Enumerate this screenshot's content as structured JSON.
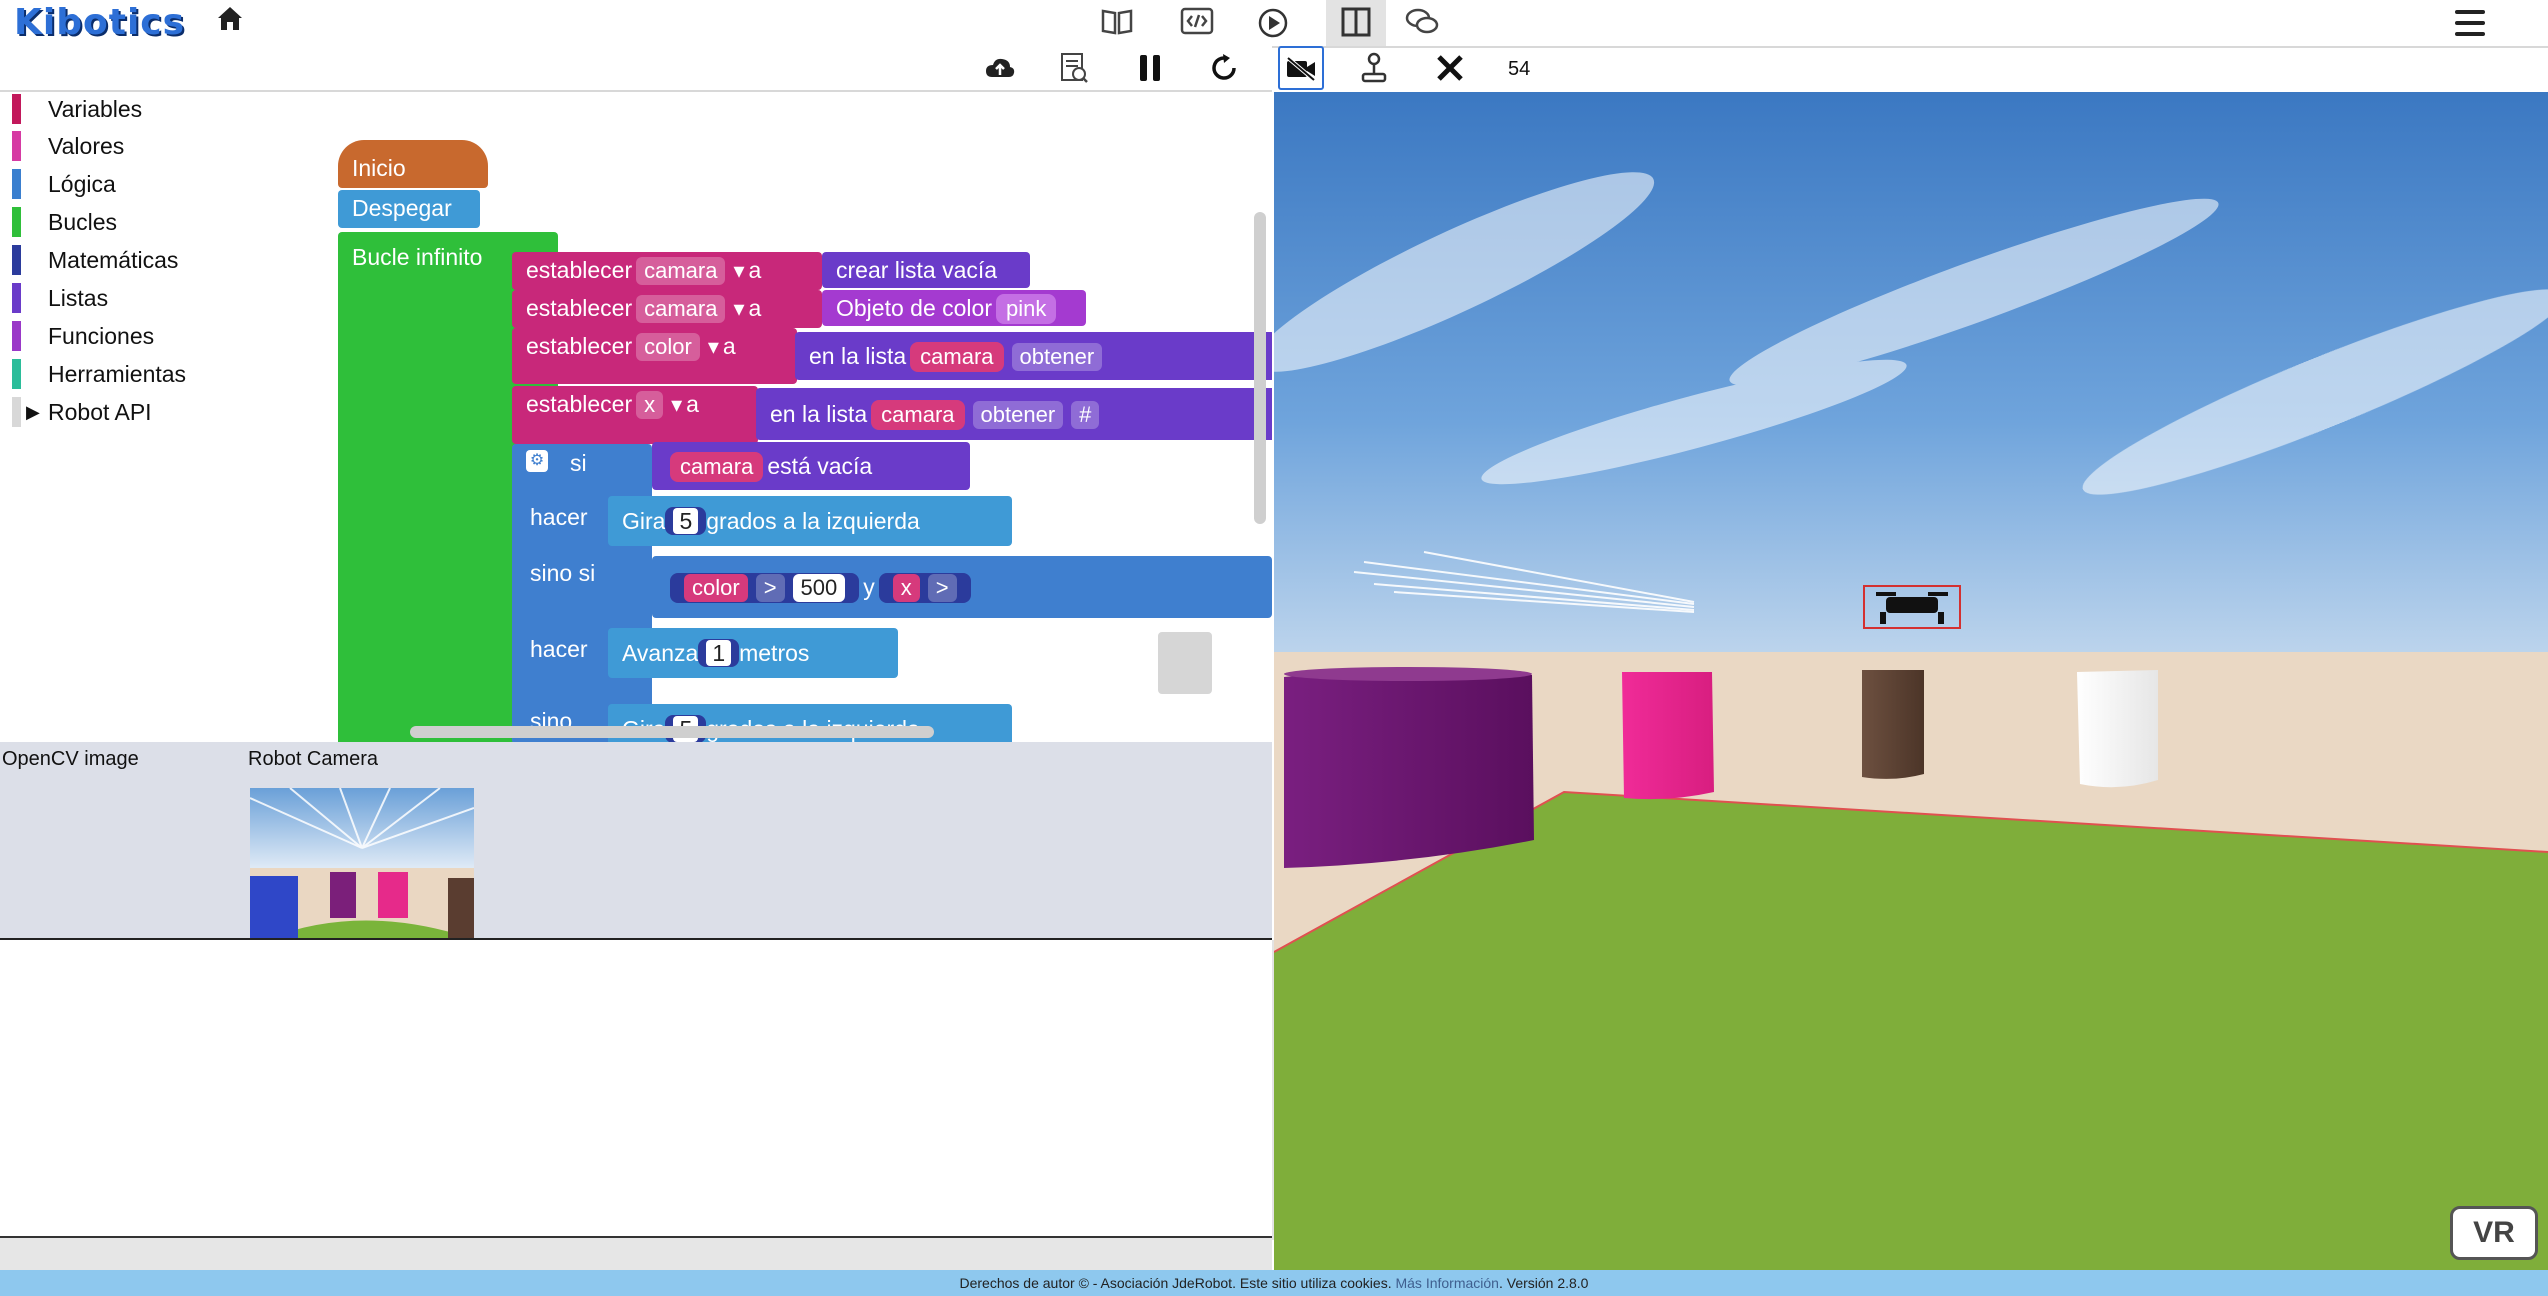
{
  "app": {
    "logo_text": "Kibotics"
  },
  "topbar": {
    "icons": [
      "home-icon",
      "book-icon",
      "code-icon",
      "play-icon",
      "layout-icon",
      "chat-icon",
      "menu-icon"
    ]
  },
  "toolbar": {
    "icons": [
      "upload-icon",
      "report-icon",
      "pause-icon",
      "reset-icon",
      "camera-off-icon",
      "joystick-icon",
      "close-icon"
    ],
    "counter": "54"
  },
  "toolbox": {
    "categories": [
      {
        "label": "Variables",
        "color": "#c2185b"
      },
      {
        "label": "Valores",
        "color": "#d63aa3"
      },
      {
        "label": "Lógica",
        "color": "#3a7fcf"
      },
      {
        "label": "Bucles",
        "color": "#2fbf3a"
      },
      {
        "label": "Matemáticas",
        "color": "#2b3b9c"
      },
      {
        "label": "Listas",
        "color": "#6a3bc9"
      },
      {
        "label": "Funciones",
        "color": "#9a38c8"
      },
      {
        "label": "Herramientas",
        "color": "#2bbd9a"
      },
      {
        "label": "Robot API",
        "color": "#d8d8d8"
      }
    ]
  },
  "blocks": {
    "inicio": "Inicio",
    "despegar": "Despegar",
    "bucle": "Bucle infinito",
    "establecer": "establecer",
    "a": "a",
    "var_camara": "camara",
    "var_color": "color",
    "var_x": "x",
    "crear_lista": "crear lista vacía",
    "objeto_color": "Objeto de color",
    "pink": "pink",
    "en_la_lista": "en la lista",
    "obtener": "obtener",
    "hash": "#",
    "si": "si",
    "esta_vacia": "está vacía",
    "hacer": "hacer",
    "gira": "Gira",
    "gira_num": "5",
    "grados_izq": "grados a la izquierda",
    "sino_si": "sino si",
    "gt": ">",
    "val_500": "500",
    "y": "y",
    "avanza": "Avanza",
    "avanza_num": "1",
    "metros": "metros",
    "sino": "sino"
  },
  "panels": {
    "opencv_label": "OpenCV image",
    "robot_camera_label": "Robot Camera"
  },
  "scene": {
    "vr_label": "VR"
  },
  "footer": {
    "text": "Derechos de autor © - Asociación JdeRobot. Este sitio utiliza cookies. ",
    "link": "Más Información",
    "version": ". Versión 2.8.0"
  }
}
